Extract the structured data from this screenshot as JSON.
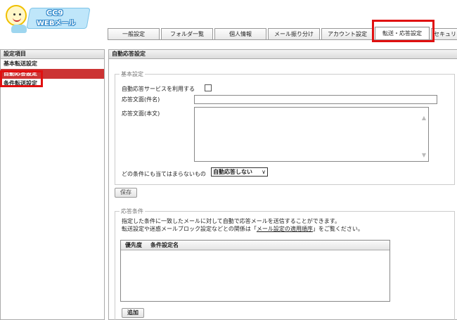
{
  "logo": {
    "line1": "CC9",
    "line2": "WEBメール"
  },
  "tabs": [
    {
      "label": "一般設定",
      "width": 74
    },
    {
      "label": "フォルダ一覧",
      "width": 74
    },
    {
      "label": "個人情報",
      "width": 74
    },
    {
      "label": "メール振り分け",
      "width": 74
    },
    {
      "label": "アカウント設定",
      "width": 74
    },
    {
      "label": "転送・応答設定",
      "width": 78
    },
    {
      "label": "セキュリ",
      "width": 40
    }
  ],
  "sidebar": {
    "title": "設定項目",
    "items": [
      {
        "label": "基本転送設定"
      },
      {
        "label": "自動応答設定"
      },
      {
        "label": "条件転送設定"
      }
    ]
  },
  "main": {
    "title": "自動応答設定",
    "basic": {
      "legend": "基本設定",
      "use_service_label": "自動応答サービスを利用する",
      "subject_label": "応答文面(件名)",
      "subject_value": "",
      "body_label": "応答文面(本文)",
      "body_value": "",
      "fallback_label": "どの条件にも当てはまらないもの",
      "fallback_value": "自動応答しない"
    },
    "save_button": "保存",
    "conditions": {
      "legend": "応答条件",
      "desc1": "指定した条件に一致したメールに対して自動で応答メールを送信することができます。",
      "desc2_prefix": "転送設定や迷惑メールブロック設定などとの関係は「",
      "desc2_link": "メール設定の適用順序",
      "desc2_suffix": "」をご覧ください。",
      "col_priority": "優先度",
      "col_name": "条件設定名",
      "add_button": "追加"
    }
  },
  "colors": {
    "highlight": "#e01010",
    "active_item": "#cc3333"
  }
}
